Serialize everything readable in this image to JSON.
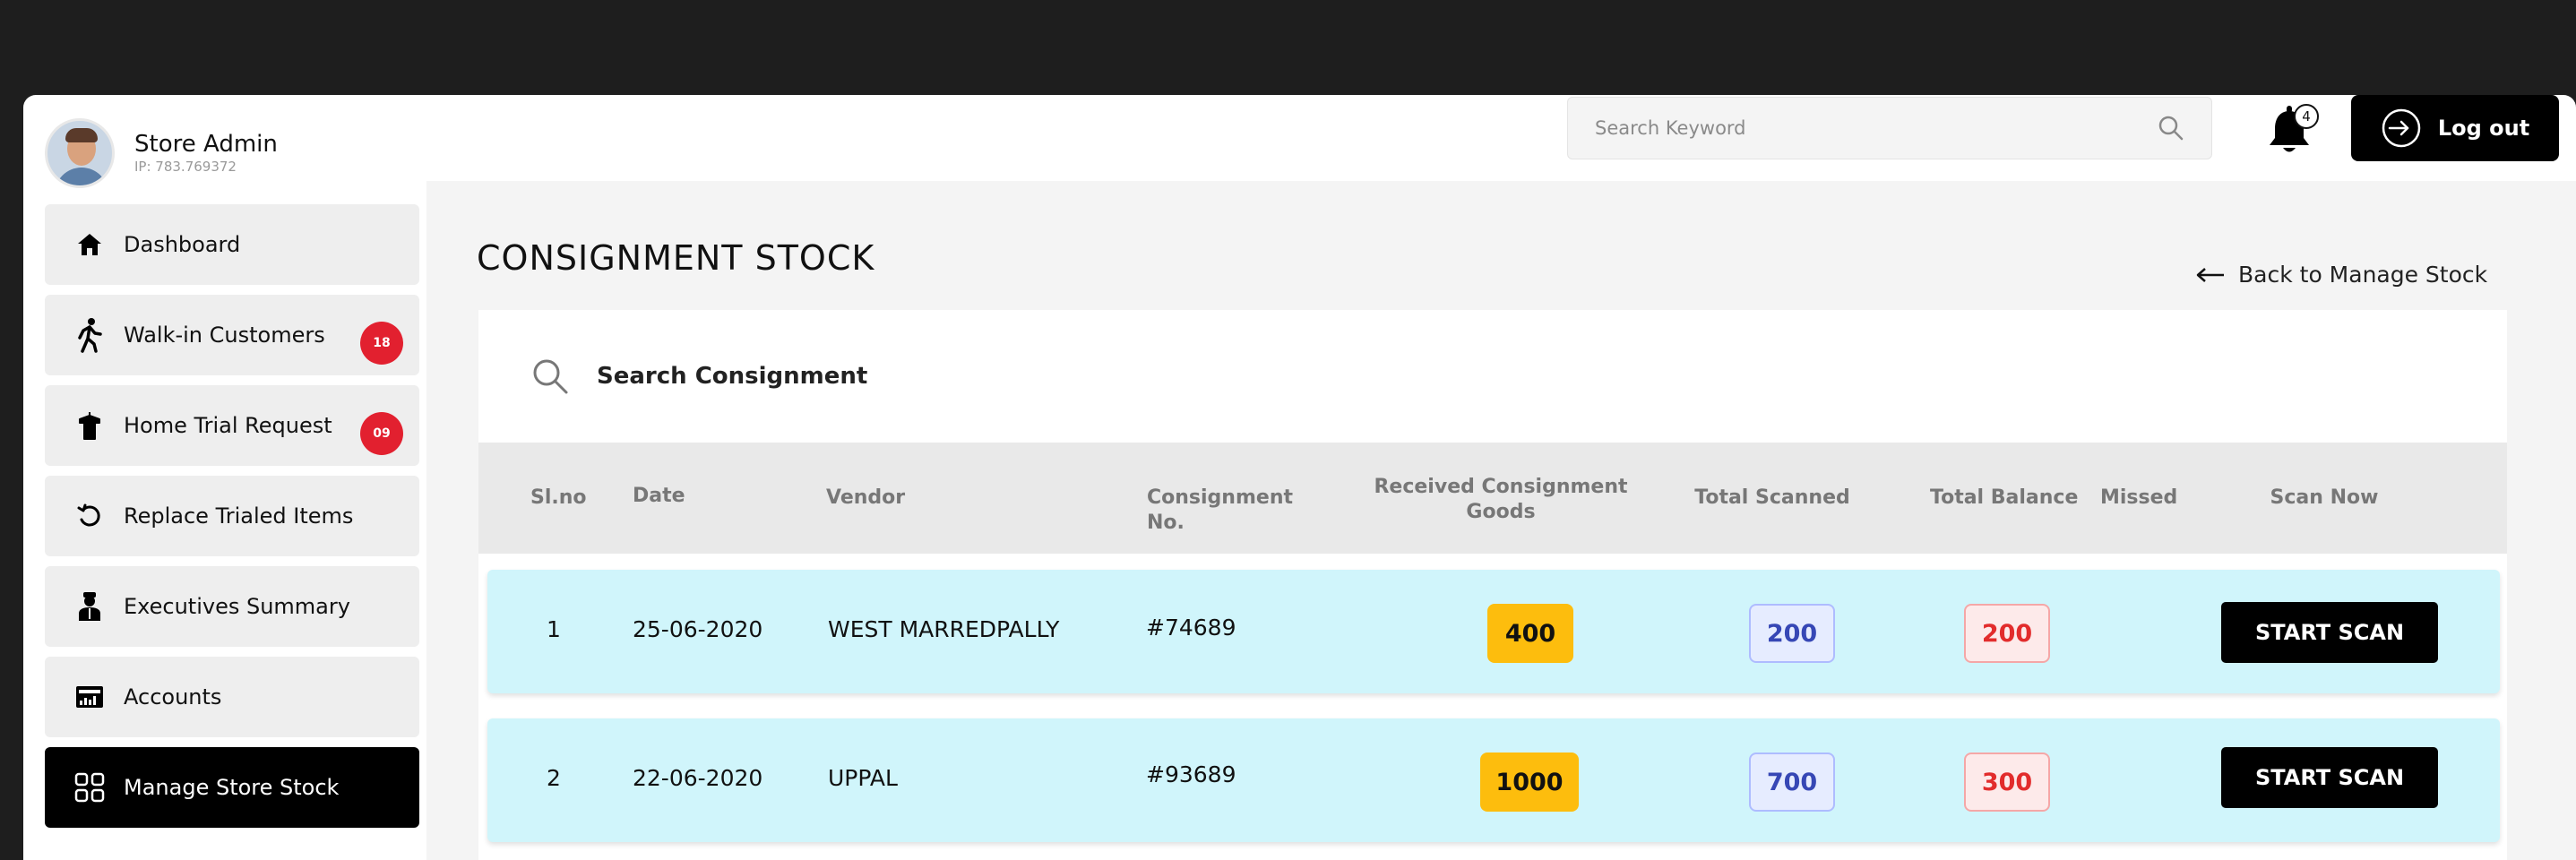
{
  "user": {
    "name": "Store Admin",
    "ip": "IP: 783.769372"
  },
  "header": {
    "search_placeholder": "Search Keyword",
    "notification_count": "4",
    "logout_label": "Log out"
  },
  "sidebar": {
    "items": [
      {
        "label": "Dashboard",
        "icon": "home-icon"
      },
      {
        "label": "Walk-in Customers",
        "icon": "walking-person-icon",
        "badge": "18"
      },
      {
        "label": "Home Trial Request",
        "icon": "dress-hanger-icon",
        "badge": "09"
      },
      {
        "label": "Replace Trialed Items",
        "icon": "rotate-icon"
      },
      {
        "label": "Executives Summary",
        "icon": "executive-person-icon"
      },
      {
        "label": "Accounts",
        "icon": "accounts-chart-icon"
      },
      {
        "label": "Manage Store Stock",
        "icon": "grid-icon",
        "active": true
      }
    ]
  },
  "page": {
    "title": "CONSIGNMENT STOCK",
    "back_link": "Back to Manage Stock",
    "search_placeholder": "Search Consignment"
  },
  "table": {
    "columns": [
      "Sl.no",
      "Date",
      "Vendor",
      "Consignment No.",
      "Received Consignment Goods",
      "Total Scanned",
      "Total Balance",
      "Missed",
      "Scan Now"
    ],
    "rows": [
      {
        "slno": "1",
        "date": "25-06-2020",
        "vendor": "WEST MARREDPALLY",
        "consignment_no": "#74689",
        "received": "400",
        "scanned": "200",
        "balance": "200",
        "missed": "",
        "action": "START SCAN"
      },
      {
        "slno": "2",
        "date": "22-06-2020",
        "vendor": "UPPAL",
        "consignment_no": "#93689",
        "received": "1000",
        "scanned": "700",
        "balance": "300",
        "missed": "",
        "action": "START SCAN"
      }
    ]
  },
  "colors": {
    "row_bg": "#d0f5fb",
    "badge_red": "#e2202f",
    "received_yellow": "#fdbd0d",
    "scanned_blue": "#3647b5",
    "balance_red": "#e22c2c"
  }
}
